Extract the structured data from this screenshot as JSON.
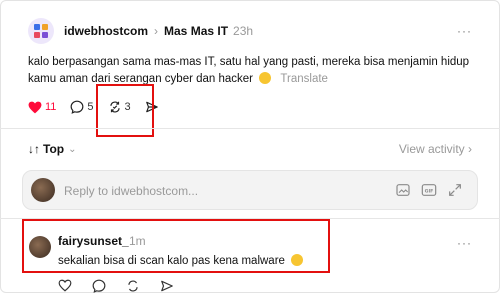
{
  "post": {
    "username": "idwebhostcom",
    "topic": "Mas Mas IT",
    "time": "23h",
    "text": "kalo berpasangan sama mas-mas IT, satu hal yang pasti, mereka bisa menjamin hidup kamu aman dari serangan cyber dan hacker",
    "emoji": "rolling-on-floor-laughing",
    "translate": "Translate",
    "more": "···",
    "like_count": "11",
    "comment_count": "5",
    "repost_count": "3"
  },
  "sort": {
    "label": "Top",
    "view_activity": "View activity ›"
  },
  "reply": {
    "placeholder": "Reply to idwebhostcom..."
  },
  "comment": {
    "username": "fairysunset_",
    "time": "1m",
    "text": "sekalian bisa di scan kalo pas kena malware",
    "emoji": "grinning-face",
    "more": "···"
  },
  "colors": {
    "like": "#ff0b3a",
    "highlight_box": "#e3100f",
    "muted": "#999999"
  }
}
